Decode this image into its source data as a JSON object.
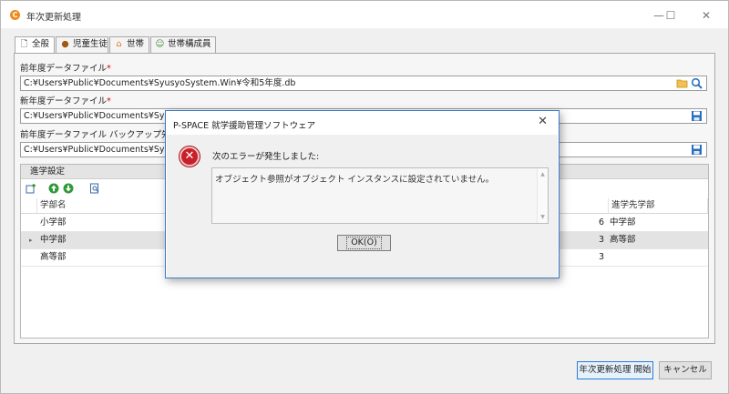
{
  "window": {
    "title": "年次更新処理",
    "controls": [
      "—",
      "☐",
      "✕"
    ]
  },
  "tabs": [
    {
      "label": "全般",
      "icon": "document-icon",
      "active": true
    },
    {
      "label": "児童生徒",
      "icon": "student-icon",
      "active": false
    },
    {
      "label": "世帯",
      "icon": "house-icon",
      "active": false
    },
    {
      "label": "世帯構成員",
      "icon": "members-icon",
      "active": false
    }
  ],
  "form": {
    "prev_db_label": "前年度データファイル",
    "prev_db_value": "C:¥Users¥Public¥Documents¥SyusyoSystem.Win¥令和5年度.db",
    "new_db_label": "新年度データファイル",
    "new_db_value": "C:¥Users¥Public¥Documents¥Syusyo",
    "backup_label": "前年度データファイル バックアップ先(ファイル",
    "backup_value": "C:¥Users¥Public¥Documents¥Syusyo",
    "required_mark": "*"
  },
  "grid": {
    "header": "進学設定",
    "columns": {
      "name": "学部名",
      "target": "進学先学部"
    },
    "rows": [
      {
        "name": "小学部",
        "num": "6",
        "target": "中学部",
        "selected": false
      },
      {
        "name": "中学部",
        "num": "3",
        "target": "高等部",
        "selected": true
      },
      {
        "name": "高等部",
        "num": "3",
        "target": "",
        "selected": false
      }
    ],
    "row_marker": "▸"
  },
  "buttons": {
    "start": "年次更新処理 開始",
    "cancel": "キャンセル"
  },
  "dialog": {
    "title": "P-SPACE 就学援助管理ソフトウェア",
    "close": "✕",
    "message": "次のエラーが発生しました:",
    "detail": "オブジェクト参照がオブジェクト インスタンスに設定されていません。",
    "ok": "OK(O)"
  },
  "colors": {
    "accent": "#3a7cc7",
    "error": "#c8202a",
    "required": "#e00000"
  }
}
